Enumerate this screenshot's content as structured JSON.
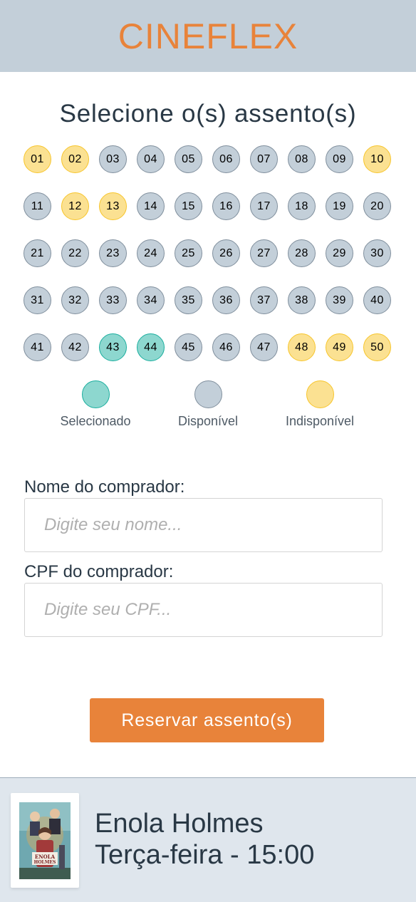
{
  "header": {
    "logo": "CINEFLEX"
  },
  "page": {
    "title": "Selecione o(s) assento(s)"
  },
  "seats": [
    {
      "label": "01",
      "status": "unavailable"
    },
    {
      "label": "02",
      "status": "unavailable"
    },
    {
      "label": "03",
      "status": "available"
    },
    {
      "label": "04",
      "status": "available"
    },
    {
      "label": "05",
      "status": "available"
    },
    {
      "label": "06",
      "status": "available"
    },
    {
      "label": "07",
      "status": "available"
    },
    {
      "label": "08",
      "status": "available"
    },
    {
      "label": "09",
      "status": "available"
    },
    {
      "label": "10",
      "status": "unavailable"
    },
    {
      "label": "11",
      "status": "available"
    },
    {
      "label": "12",
      "status": "unavailable"
    },
    {
      "label": "13",
      "status": "unavailable"
    },
    {
      "label": "14",
      "status": "available"
    },
    {
      "label": "15",
      "status": "available"
    },
    {
      "label": "16",
      "status": "available"
    },
    {
      "label": "17",
      "status": "available"
    },
    {
      "label": "18",
      "status": "available"
    },
    {
      "label": "19",
      "status": "available"
    },
    {
      "label": "20",
      "status": "available"
    },
    {
      "label": "21",
      "status": "available"
    },
    {
      "label": "22",
      "status": "available"
    },
    {
      "label": "23",
      "status": "available"
    },
    {
      "label": "24",
      "status": "available"
    },
    {
      "label": "25",
      "status": "available"
    },
    {
      "label": "26",
      "status": "available"
    },
    {
      "label": "27",
      "status": "available"
    },
    {
      "label": "28",
      "status": "available"
    },
    {
      "label": "29",
      "status": "available"
    },
    {
      "label": "30",
      "status": "available"
    },
    {
      "label": "31",
      "status": "available"
    },
    {
      "label": "32",
      "status": "available"
    },
    {
      "label": "33",
      "status": "available"
    },
    {
      "label": "34",
      "status": "available"
    },
    {
      "label": "35",
      "status": "available"
    },
    {
      "label": "36",
      "status": "available"
    },
    {
      "label": "37",
      "status": "available"
    },
    {
      "label": "38",
      "status": "available"
    },
    {
      "label": "39",
      "status": "available"
    },
    {
      "label": "40",
      "status": "available"
    },
    {
      "label": "41",
      "status": "available"
    },
    {
      "label": "42",
      "status": "available"
    },
    {
      "label": "43",
      "status": "selected"
    },
    {
      "label": "44",
      "status": "selected"
    },
    {
      "label": "45",
      "status": "available"
    },
    {
      "label": "46",
      "status": "available"
    },
    {
      "label": "47",
      "status": "available"
    },
    {
      "label": "48",
      "status": "unavailable"
    },
    {
      "label": "49",
      "status": "unavailable"
    },
    {
      "label": "50",
      "status": "unavailable"
    }
  ],
  "legend": {
    "selected": "Selecionado",
    "available": "Disponível",
    "unavailable": "Indisponível"
  },
  "colors": {
    "selected_fill": "#8DD7CF",
    "selected_border": "#1AAE9E",
    "available_fill": "#C3CFD9",
    "available_border": "#808F9D",
    "unavailable_fill": "#FBE192",
    "unavailable_border": "#F7C52B",
    "accent": "#E8833A"
  },
  "form": {
    "name_label": "Nome do comprador:",
    "name_placeholder": "Digite seu nome...",
    "name_value": "",
    "cpf_label": "CPF do comprador:",
    "cpf_placeholder": "Digite seu CPF...",
    "cpf_value": ""
  },
  "actions": {
    "reserve_label": "Reservar assento(s)"
  },
  "footer": {
    "movie_title": "Enola Holmes",
    "session": "Terça-feira - 15:00",
    "poster_text": "ENOLA HOLMES",
    "poster_icon": "movie-poster-image"
  }
}
